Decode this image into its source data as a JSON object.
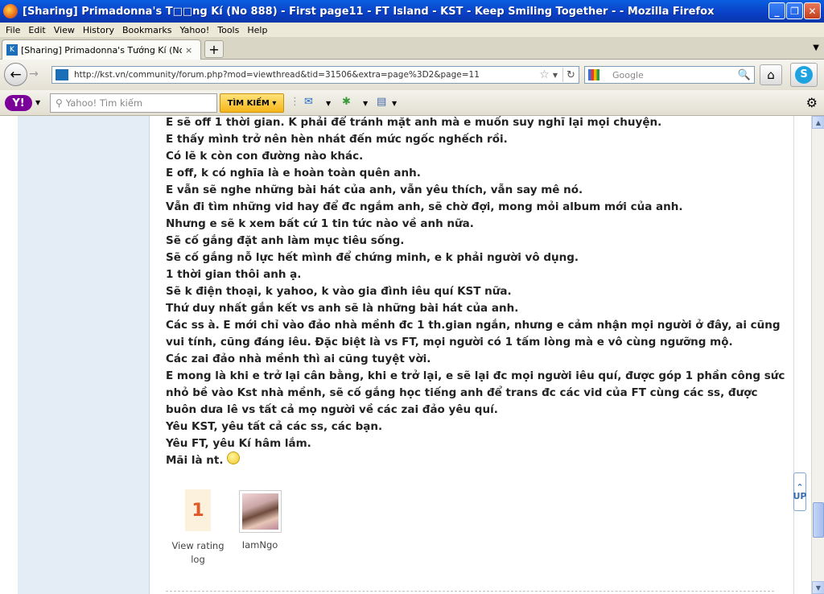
{
  "window": {
    "title": "[Sharing] Primadonna's T□□ng Kí (No 888) - First page11 - FT Island - KST - Keep Smiling Together - - Mozilla Firefox",
    "minimize": "_",
    "maximize": "❐",
    "close": "✕"
  },
  "menu": [
    "File",
    "Edit",
    "View",
    "History",
    "Bookmarks",
    "Yahoo!",
    "Tools",
    "Help"
  ],
  "tab": {
    "label": "[Sharing] Primadonna's Tướng Kí (No 888) - ...",
    "close": "×",
    "new_tab": "+",
    "menu": "▼"
  },
  "nav": {
    "back": "←",
    "forward": "→",
    "url": "http://kst.vn/community/forum.php?mod=viewthread&tid=31506&extra=page%3D2&page=11",
    "star": "☆",
    "reload": "↻",
    "search_placeholder": "Google",
    "search_icon": "🔍",
    "home": "⌂"
  },
  "yahoo": {
    "logo": "Y!",
    "search_placeholder": "Yahoo! Tìm kiếm",
    "search_button": "TÌM KIẾM ▾"
  },
  "post": {
    "lines": [
      "E sẽ off 1 thời gian. K phải để tránh mặt anh mà e muốn suy nghĩ lại mọi chuyện.",
      "E thấy mình trở nên hèn nhát đến mức ngốc nghếch rồi.",
      "Có lẽ k còn con đường nào khác.",
      "E off, k có nghĩa là e hoàn toàn quên anh.",
      "E vẫn sẽ nghe những bài hát của anh, vẫn yêu thích, vẫn say mê nó.",
      "Vẫn đi tìm những vid hay để đc ngắm anh, sẽ chờ đợi, mong mỏi album mới của anh.",
      "Nhưng e sẽ k xem bất cứ 1 tin tức nào về anh nữa.",
      "Sẽ cố gắng đặt anh làm mục tiêu sống.",
      "Sẽ cố gắng nỗ lực hết mình để chứng minh, e k phải người vô dụng.",
      "1 thời gian thôi anh ạ.",
      "Sẽ k điện thoại, k yahoo, k vào gia đình iêu quí KST nữa.",
      "Thứ duy nhất gắn kết vs anh sẽ là những bài hát của anh.",
      "Các ss à. E mới chỉ vào đảo nhà mềnh đc 1 th.gian ngắn, nhưng e cảm nhận mọi người ở đây, ai cũng vui tính, cũng đáng iêu. Đặc biệt là vs FT, mọi người có 1 tấm lòng mà e vô cùng ngưỡng mộ.",
      "Các zai đảo nhà mềnh thì ai cũng tuyệt vời.",
      "E mong là khi e trở lại cân bằng, khi e trở lại, e sẽ lại đc mọi người iêu quí, được góp 1 phần công sức nhỏ bề vào Kst nhà mềnh, sẽ cố gắng học tiếng anh để trans đc các vid của FT cùng các ss, được buôn dưa lê vs tất cả mọ người về các zai đảo yêu quí.",
      "Yêu KST, yêu tất cả các ss, các bạn.",
      "Yêu FT, yêu Kí hâm lắm.",
      "Mãi là nt."
    ],
    "rating_value": "1",
    "rating_label": "View rating log",
    "rater_name": "IamNgo"
  },
  "up_button": "UP",
  "colors": {
    "titlebar": "#0a4fd6",
    "sidebar": "#e4ecf5",
    "rating": "#e05a28"
  }
}
